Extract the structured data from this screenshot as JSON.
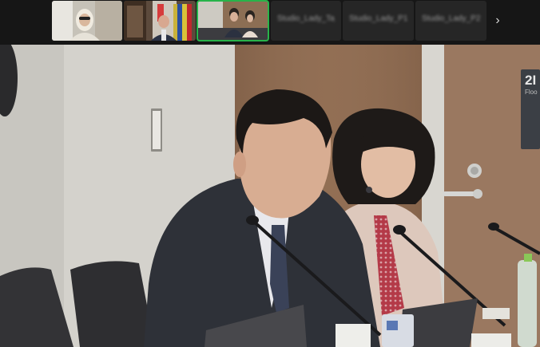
{
  "participants": [
    {
      "label": ""
    },
    {
      "label": ""
    },
    {
      "label": ""
    },
    {
      "label": "Studio_Lady_Taj"
    },
    {
      "label": "Studio_Lady_P1"
    },
    {
      "label": "Studio_Lady_P2"
    }
  ],
  "nav": {
    "next_icon": "chevron-right-icon",
    "next_glyph": "›"
  },
  "room_sign": {
    "number": "2I",
    "floor": "Floo"
  },
  "colors": {
    "active_tile": "#28b34a"
  }
}
